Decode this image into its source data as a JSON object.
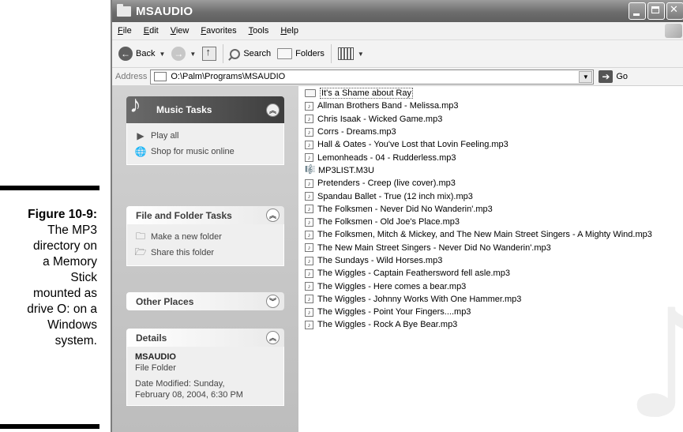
{
  "caption": {
    "figure": "Figure 10-9:",
    "lines": [
      "The MP3",
      "directory on",
      "a Memory",
      "Stick",
      "mounted as",
      "drive O: on a",
      "Windows",
      "system."
    ]
  },
  "window": {
    "title": "MSAUDIO",
    "menu": [
      "File",
      "Edit",
      "View",
      "Favorites",
      "Tools",
      "Help"
    ],
    "toolbar": {
      "back": "Back",
      "search": "Search",
      "folders": "Folders"
    },
    "address": {
      "label": "Address",
      "value": "O:\\Palm\\Programs\\MSAUDIO",
      "go": "Go"
    }
  },
  "taskpane": {
    "music_tasks": {
      "title": "Music Tasks",
      "items": [
        "Play all",
        "Shop for music online"
      ]
    },
    "file_folder_tasks": {
      "title": "File and Folder Tasks",
      "items": [
        "Make a new folder",
        "Share this folder"
      ]
    },
    "other_places": {
      "title": "Other Places"
    },
    "details": {
      "title": "Details",
      "name": "MSAUDIO",
      "type": "File Folder",
      "modified_line1": "Date Modified: Sunday,",
      "modified_line2": "February 08, 2004, 6:30 PM"
    }
  },
  "files": [
    {
      "name": "It's a Shame about Ray",
      "kind": "folder"
    },
    {
      "name": "Allman Brothers Band - Melissa.mp3",
      "kind": "mp3"
    },
    {
      "name": "Chris Isaak - Wicked Game.mp3",
      "kind": "mp3"
    },
    {
      "name": "Corrs - Dreams.mp3",
      "kind": "mp3"
    },
    {
      "name": "Hall & Oates - You've Lost that Lovin Feeling.mp3",
      "kind": "mp3"
    },
    {
      "name": "Lemonheads - 04 - Rudderless.mp3",
      "kind": "mp3"
    },
    {
      "name": "MP3LIST.M3U",
      "kind": "playlist"
    },
    {
      "name": "Pretenders - Creep (live cover).mp3",
      "kind": "mp3"
    },
    {
      "name": "Spandau Ballet - True (12 inch mix).mp3",
      "kind": "mp3"
    },
    {
      "name": "The Folksmen - Never Did No Wanderin'.mp3",
      "kind": "mp3"
    },
    {
      "name": "The Folksmen - Old Joe's Place.mp3",
      "kind": "mp3"
    },
    {
      "name": "The Folksmen, Mitch & Mickey, and The New Main Street Singers - A Mighty Wind.mp3",
      "kind": "mp3"
    },
    {
      "name": "The New Main Street Singers - Never Did No Wanderin'.mp3",
      "kind": "mp3"
    },
    {
      "name": "The Sundays - Wild Horses.mp3",
      "kind": "mp3"
    },
    {
      "name": "The Wiggles - Captain Feathersword fell asle.mp3",
      "kind": "mp3"
    },
    {
      "name": "The Wiggles - Here comes a bear.mp3",
      "kind": "mp3"
    },
    {
      "name": "The Wiggles - Johnny Works With One Hammer.mp3",
      "kind": "mp3"
    },
    {
      "name": "The Wiggles - Point Your Fingers....mp3",
      "kind": "mp3"
    },
    {
      "name": "The Wiggles - Rock A Bye Bear.mp3",
      "kind": "mp3"
    }
  ]
}
